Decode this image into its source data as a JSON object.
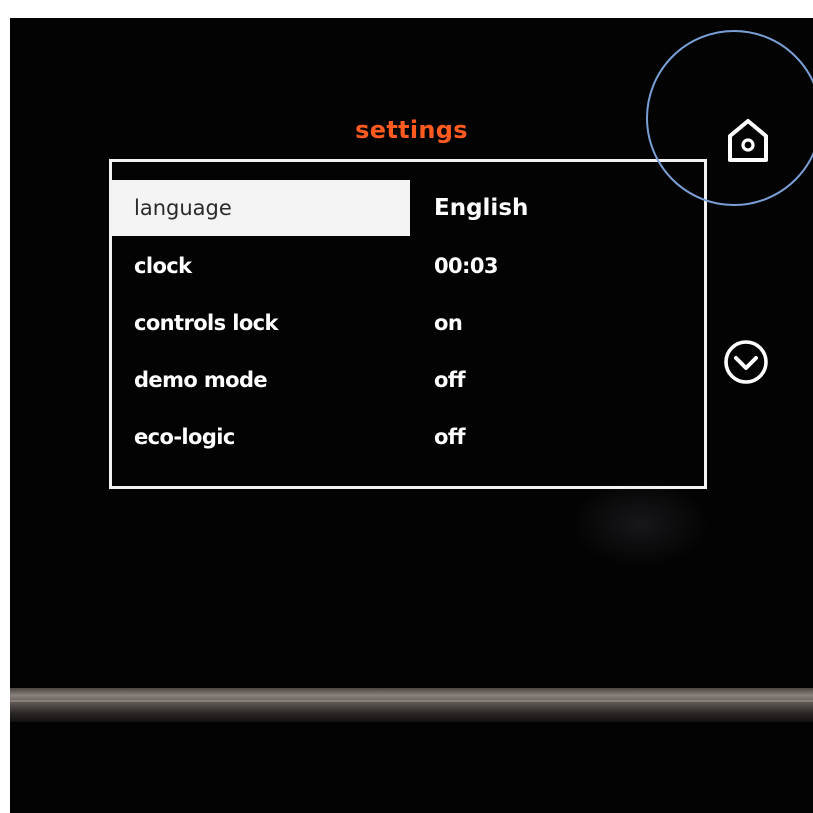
{
  "screen": {
    "title": "settings",
    "title_color": "#ff5a1f",
    "selected_index": 0,
    "rows": [
      {
        "label": "language",
        "value": "English"
      },
      {
        "label": "clock",
        "value": "00:03"
      },
      {
        "label": "controls lock",
        "value": "on"
      },
      {
        "label": "demo mode",
        "value": "off"
      },
      {
        "label": "eco-logic",
        "value": "off"
      }
    ]
  },
  "side_controls": {
    "home_icon": "home-icon",
    "down_icon": "chevron-down-circle-icon"
  },
  "annotation": {
    "highlight_color": "#7a9fd6"
  }
}
